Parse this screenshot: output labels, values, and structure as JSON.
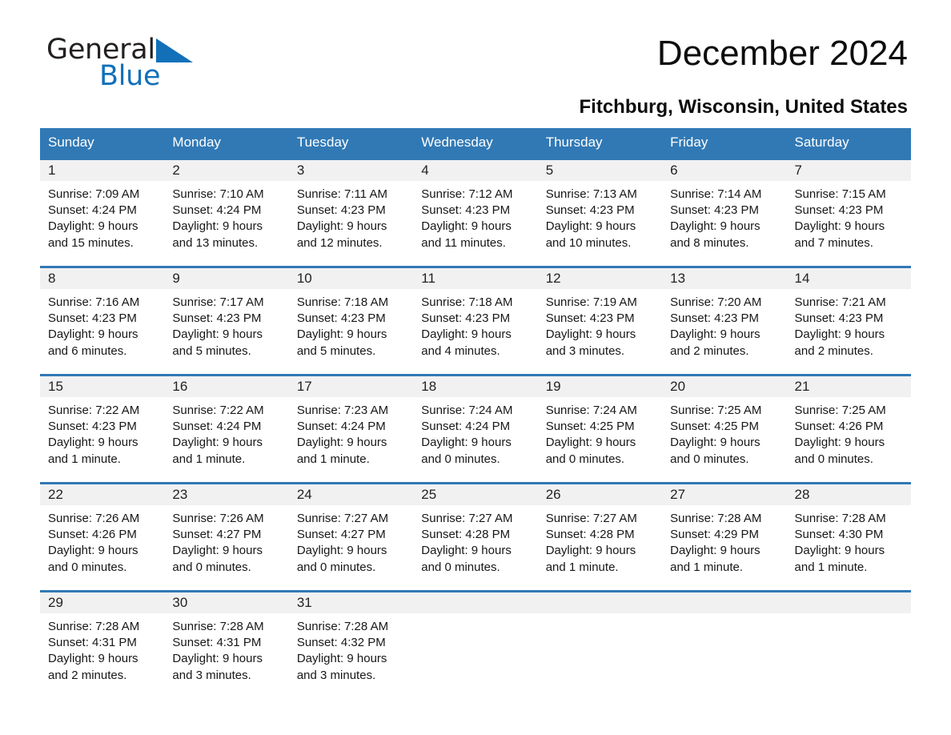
{
  "brand": {
    "name_part1": "General",
    "name_part2": "Blue",
    "accent_color": "#1270b9",
    "triangle_icon": "triangle-logo-icon"
  },
  "header": {
    "month_title": "December 2024",
    "location": "Fitchburg, Wisconsin, United States"
  },
  "calendar": {
    "header_bg": "#3179b5",
    "daynum_bg": "#f1f1f1",
    "weekday_headers": [
      "Sunday",
      "Monday",
      "Tuesday",
      "Wednesday",
      "Thursday",
      "Friday",
      "Saturday"
    ],
    "weeks": [
      [
        {
          "day": "1",
          "sunrise": "Sunrise: 7:09 AM",
          "sunset": "Sunset: 4:24 PM",
          "daylight_line1": "Daylight: 9 hours",
          "daylight_line2": "and 15 minutes."
        },
        {
          "day": "2",
          "sunrise": "Sunrise: 7:10 AM",
          "sunset": "Sunset: 4:24 PM",
          "daylight_line1": "Daylight: 9 hours",
          "daylight_line2": "and 13 minutes."
        },
        {
          "day": "3",
          "sunrise": "Sunrise: 7:11 AM",
          "sunset": "Sunset: 4:23 PM",
          "daylight_line1": "Daylight: 9 hours",
          "daylight_line2": "and 12 minutes."
        },
        {
          "day": "4",
          "sunrise": "Sunrise: 7:12 AM",
          "sunset": "Sunset: 4:23 PM",
          "daylight_line1": "Daylight: 9 hours",
          "daylight_line2": "and 11 minutes."
        },
        {
          "day": "5",
          "sunrise": "Sunrise: 7:13 AM",
          "sunset": "Sunset: 4:23 PM",
          "daylight_line1": "Daylight: 9 hours",
          "daylight_line2": "and 10 minutes."
        },
        {
          "day": "6",
          "sunrise": "Sunrise: 7:14 AM",
          "sunset": "Sunset: 4:23 PM",
          "daylight_line1": "Daylight: 9 hours",
          "daylight_line2": "and 8 minutes."
        },
        {
          "day": "7",
          "sunrise": "Sunrise: 7:15 AM",
          "sunset": "Sunset: 4:23 PM",
          "daylight_line1": "Daylight: 9 hours",
          "daylight_line2": "and 7 minutes."
        }
      ],
      [
        {
          "day": "8",
          "sunrise": "Sunrise: 7:16 AM",
          "sunset": "Sunset: 4:23 PM",
          "daylight_line1": "Daylight: 9 hours",
          "daylight_line2": "and 6 minutes."
        },
        {
          "day": "9",
          "sunrise": "Sunrise: 7:17 AM",
          "sunset": "Sunset: 4:23 PM",
          "daylight_line1": "Daylight: 9 hours",
          "daylight_line2": "and 5 minutes."
        },
        {
          "day": "10",
          "sunrise": "Sunrise: 7:18 AM",
          "sunset": "Sunset: 4:23 PM",
          "daylight_line1": "Daylight: 9 hours",
          "daylight_line2": "and 5 minutes."
        },
        {
          "day": "11",
          "sunrise": "Sunrise: 7:18 AM",
          "sunset": "Sunset: 4:23 PM",
          "daylight_line1": "Daylight: 9 hours",
          "daylight_line2": "and 4 minutes."
        },
        {
          "day": "12",
          "sunrise": "Sunrise: 7:19 AM",
          "sunset": "Sunset: 4:23 PM",
          "daylight_line1": "Daylight: 9 hours",
          "daylight_line2": "and 3 minutes."
        },
        {
          "day": "13",
          "sunrise": "Sunrise: 7:20 AM",
          "sunset": "Sunset: 4:23 PM",
          "daylight_line1": "Daylight: 9 hours",
          "daylight_line2": "and 2 minutes."
        },
        {
          "day": "14",
          "sunrise": "Sunrise: 7:21 AM",
          "sunset": "Sunset: 4:23 PM",
          "daylight_line1": "Daylight: 9 hours",
          "daylight_line2": "and 2 minutes."
        }
      ],
      [
        {
          "day": "15",
          "sunrise": "Sunrise: 7:22 AM",
          "sunset": "Sunset: 4:23 PM",
          "daylight_line1": "Daylight: 9 hours",
          "daylight_line2": "and 1 minute."
        },
        {
          "day": "16",
          "sunrise": "Sunrise: 7:22 AM",
          "sunset": "Sunset: 4:24 PM",
          "daylight_line1": "Daylight: 9 hours",
          "daylight_line2": "and 1 minute."
        },
        {
          "day": "17",
          "sunrise": "Sunrise: 7:23 AM",
          "sunset": "Sunset: 4:24 PM",
          "daylight_line1": "Daylight: 9 hours",
          "daylight_line2": "and 1 minute."
        },
        {
          "day": "18",
          "sunrise": "Sunrise: 7:24 AM",
          "sunset": "Sunset: 4:24 PM",
          "daylight_line1": "Daylight: 9 hours",
          "daylight_line2": "and 0 minutes."
        },
        {
          "day": "19",
          "sunrise": "Sunrise: 7:24 AM",
          "sunset": "Sunset: 4:25 PM",
          "daylight_line1": "Daylight: 9 hours",
          "daylight_line2": "and 0 minutes."
        },
        {
          "day": "20",
          "sunrise": "Sunrise: 7:25 AM",
          "sunset": "Sunset: 4:25 PM",
          "daylight_line1": "Daylight: 9 hours",
          "daylight_line2": "and 0 minutes."
        },
        {
          "day": "21",
          "sunrise": "Sunrise: 7:25 AM",
          "sunset": "Sunset: 4:26 PM",
          "daylight_line1": "Daylight: 9 hours",
          "daylight_line2": "and 0 minutes."
        }
      ],
      [
        {
          "day": "22",
          "sunrise": "Sunrise: 7:26 AM",
          "sunset": "Sunset: 4:26 PM",
          "daylight_line1": "Daylight: 9 hours",
          "daylight_line2": "and 0 minutes."
        },
        {
          "day": "23",
          "sunrise": "Sunrise: 7:26 AM",
          "sunset": "Sunset: 4:27 PM",
          "daylight_line1": "Daylight: 9 hours",
          "daylight_line2": "and 0 minutes."
        },
        {
          "day": "24",
          "sunrise": "Sunrise: 7:27 AM",
          "sunset": "Sunset: 4:27 PM",
          "daylight_line1": "Daylight: 9 hours",
          "daylight_line2": "and 0 minutes."
        },
        {
          "day": "25",
          "sunrise": "Sunrise: 7:27 AM",
          "sunset": "Sunset: 4:28 PM",
          "daylight_line1": "Daylight: 9 hours",
          "daylight_line2": "and 0 minutes."
        },
        {
          "day": "26",
          "sunrise": "Sunrise: 7:27 AM",
          "sunset": "Sunset: 4:28 PM",
          "daylight_line1": "Daylight: 9 hours",
          "daylight_line2": "and 1 minute."
        },
        {
          "day": "27",
          "sunrise": "Sunrise: 7:28 AM",
          "sunset": "Sunset: 4:29 PM",
          "daylight_line1": "Daylight: 9 hours",
          "daylight_line2": "and 1 minute."
        },
        {
          "day": "28",
          "sunrise": "Sunrise: 7:28 AM",
          "sunset": "Sunset: 4:30 PM",
          "daylight_line1": "Daylight: 9 hours",
          "daylight_line2": "and 1 minute."
        }
      ],
      [
        {
          "day": "29",
          "sunrise": "Sunrise: 7:28 AM",
          "sunset": "Sunset: 4:31 PM",
          "daylight_line1": "Daylight: 9 hours",
          "daylight_line2": "and 2 minutes."
        },
        {
          "day": "30",
          "sunrise": "Sunrise: 7:28 AM",
          "sunset": "Sunset: 4:31 PM",
          "daylight_line1": "Daylight: 9 hours",
          "daylight_line2": "and 3 minutes."
        },
        {
          "day": "31",
          "sunrise": "Sunrise: 7:28 AM",
          "sunset": "Sunset: 4:32 PM",
          "daylight_line1": "Daylight: 9 hours",
          "daylight_line2": "and 3 minutes."
        },
        {
          "day": "",
          "sunrise": "",
          "sunset": "",
          "daylight_line1": "",
          "daylight_line2": ""
        },
        {
          "day": "",
          "sunrise": "",
          "sunset": "",
          "daylight_line1": "",
          "daylight_line2": ""
        },
        {
          "day": "",
          "sunrise": "",
          "sunset": "",
          "daylight_line1": "",
          "daylight_line2": ""
        },
        {
          "day": "",
          "sunrise": "",
          "sunset": "",
          "daylight_line1": "",
          "daylight_line2": ""
        }
      ]
    ]
  }
}
